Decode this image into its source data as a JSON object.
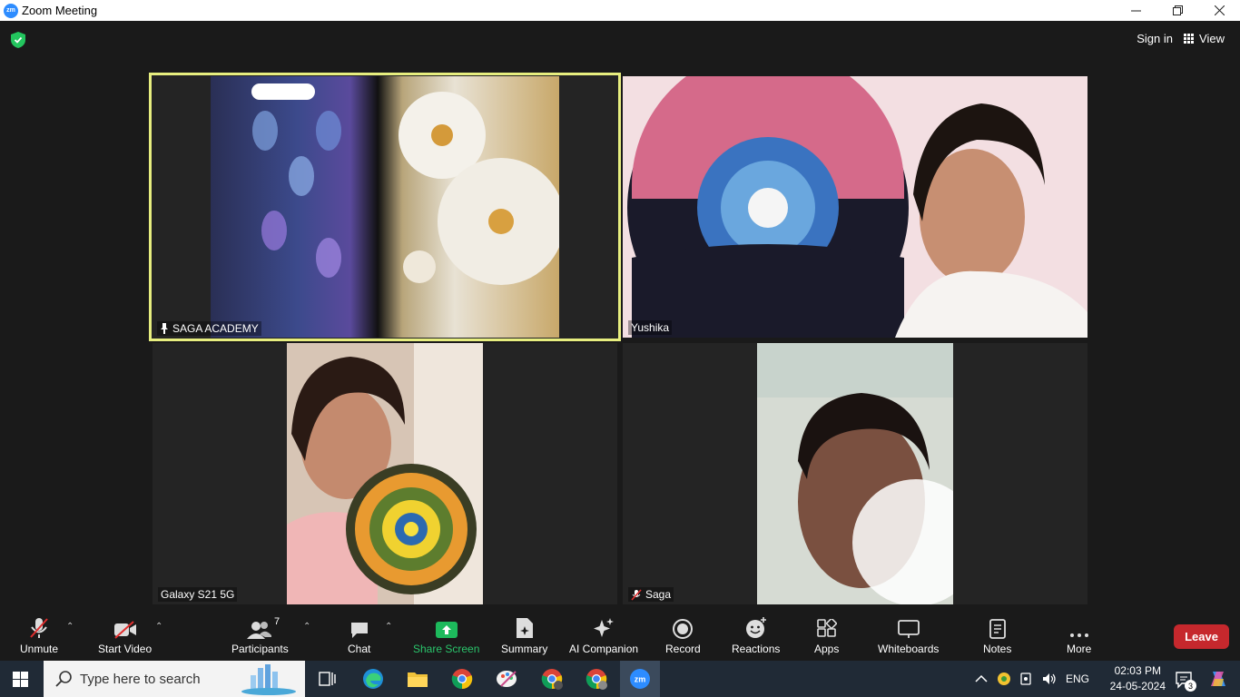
{
  "window": {
    "title": "Zoom Meeting",
    "logo_text": "zm"
  },
  "header": {
    "sign_in": "Sign in",
    "view": "View"
  },
  "tiles": [
    {
      "name": "SAGA ACADEMY",
      "active": true,
      "pinned": true,
      "muted": false
    },
    {
      "name": "Yushika",
      "active": false,
      "muted": false
    },
    {
      "name": "Galaxy S21 5G",
      "active": false,
      "muted": false
    },
    {
      "name": "Saga",
      "active": false,
      "muted": true
    }
  ],
  "toolbar": {
    "unmute": "Unmute",
    "start_video": "Start Video",
    "participants": "Participants",
    "participants_count": "7",
    "chat": "Chat",
    "share_screen": "Share Screen",
    "summary": "Summary",
    "ai_companion": "AI Companion",
    "record": "Record",
    "reactions": "Reactions",
    "apps": "Apps",
    "whiteboards": "Whiteboards",
    "notes": "Notes",
    "more": "More",
    "leave": "Leave"
  },
  "taskbar": {
    "search_placeholder": "Type here to search",
    "language": "ENG",
    "time": "02:03 PM",
    "date": "24-05-2024",
    "notifications": "3"
  }
}
